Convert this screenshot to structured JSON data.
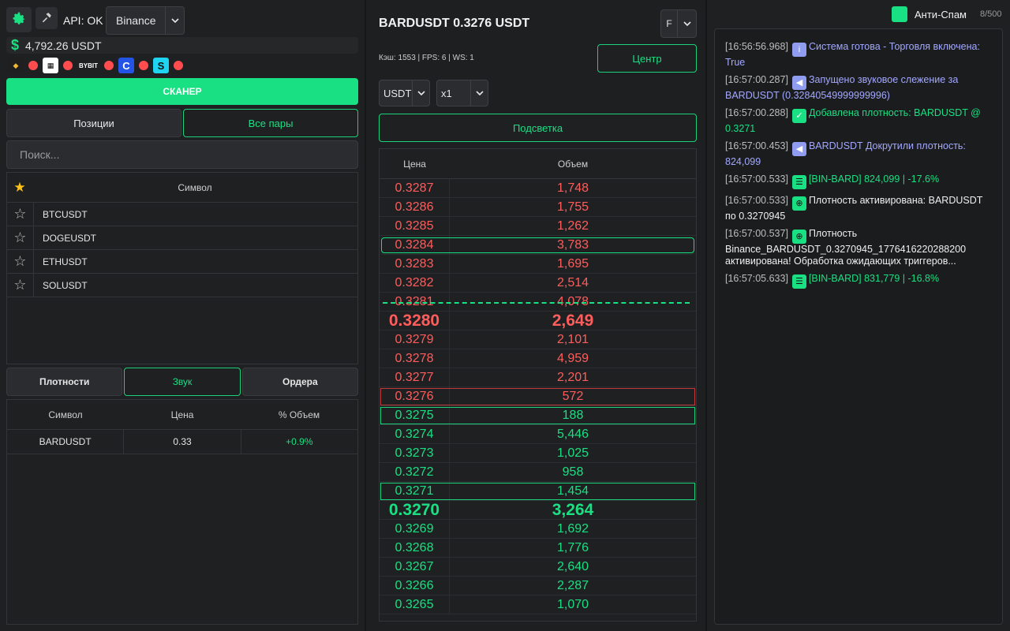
{
  "header": {
    "api_status": "API: OK",
    "exchange": "Binance",
    "balance": "4,792.26 USDT",
    "exchanges": [
      "binance-icon",
      "okx-icon",
      "bybit-icon",
      "gate-icon",
      "mexc-icon"
    ]
  },
  "scanner_label": "СКАНЕР",
  "tabs_top": {
    "positions": "Позиции",
    "all_pairs": "Все пары"
  },
  "search": {
    "placeholder": "Поиск..."
  },
  "symbols": {
    "header": "Символ",
    "items": [
      "BTCUSDT",
      "DOGEUSDT",
      "ETHUSDT",
      "SOLUSDT"
    ]
  },
  "tabs_bottom": {
    "density": "Плотности",
    "sound": "Звук",
    "orders": "Ордера"
  },
  "density_table": {
    "headers": [
      "Символ",
      "Цена",
      "% Объем"
    ],
    "rows": [
      {
        "symbol": "BARDUSDT",
        "price": "0.33",
        "pct": "+0.9%"
      }
    ]
  },
  "middle": {
    "pair_title": "BARDUSDT 0.3276 USDT",
    "f_select": "F",
    "stats": "Кэш: 1553 | FPS: 6 | WS: 1",
    "center_btn": "Центр",
    "currency_select": "USDT",
    "multiplier_select": "x1",
    "highlight_btn": "Подсветка",
    "book_headers": {
      "price": "Цена",
      "volume": "Объем"
    },
    "asks": [
      {
        "p": "0.3287",
        "v": "1,748"
      },
      {
        "p": "0.3286",
        "v": "1,755"
      },
      {
        "p": "0.3285",
        "v": "1,262"
      },
      {
        "p": "0.3284",
        "v": "3,783"
      },
      {
        "p": "0.3283",
        "v": "1,695"
      },
      {
        "p": "0.3282",
        "v": "2,514"
      },
      {
        "p": "0.3281",
        "v": "4,078"
      },
      {
        "p": "0.3280",
        "v": "2,649"
      },
      {
        "p": "0.3279",
        "v": "2,101"
      },
      {
        "p": "0.3278",
        "v": "4,959"
      },
      {
        "p": "0.3277",
        "v": "2,201"
      },
      {
        "p": "0.3276",
        "v": "572"
      }
    ],
    "bids": [
      {
        "p": "0.3275",
        "v": "188"
      },
      {
        "p": "0.3274",
        "v": "5,446"
      },
      {
        "p": "0.3273",
        "v": "1,025"
      },
      {
        "p": "0.3272",
        "v": "958"
      },
      {
        "p": "0.3271",
        "v": "1,454"
      },
      {
        "p": "0.3270",
        "v": "3,264"
      },
      {
        "p": "0.3269",
        "v": "1,692"
      },
      {
        "p": "0.3268",
        "v": "1,776"
      },
      {
        "p": "0.3267",
        "v": "2,640"
      },
      {
        "p": "0.3266",
        "v": "2,287"
      },
      {
        "p": "0.3265",
        "v": "1,070"
      }
    ]
  },
  "right": {
    "antispam": "Анти-Спам",
    "counter": "8/500",
    "log": [
      {
        "ts": "[16:56:56.968]",
        "icon": "info-icon",
        "text": "Система готова - Торговля включена: True",
        "color": "blue"
      },
      {
        "ts": "[16:57:00.287]",
        "icon": "sound-icon",
        "text": "Запущено звуковое слежение за BARDUSDT (0.32840549999999996)",
        "color": "blue"
      },
      {
        "ts": "[16:57:00.288]",
        "icon": "check-icon",
        "text": "Добавлена плотность: BARDUSDT @ 0.3271",
        "color": "green"
      },
      {
        "ts": "[16:57:00.453]",
        "icon": "sound-icon",
        "text": "BARDUSDT Докрутили плотность: 824,099",
        "color": "blue"
      },
      {
        "ts": "[16:57:00.533]",
        "icon": "list-icon",
        "text": "[BIN-BARD] 824,099 | -17.6%",
        "color": "green"
      },
      {
        "ts": "[16:57:00.533]",
        "icon": "target-icon",
        "text": "Плотность активирована: BARDUSDT по 0.3270945",
        "color": "white"
      },
      {
        "ts": "[16:57:00.537]",
        "icon": "target-icon",
        "text": "Плотность Binance_BARDUSDT_0.3270945_1776416220288200 активирована! Обработка ожидающих триггеров...",
        "color": "white"
      },
      {
        "ts": "[16:57:05.633]",
        "icon": "list-icon",
        "text": "[BIN-BARD] 831,779 | -16.8%",
        "color": "green"
      }
    ]
  }
}
